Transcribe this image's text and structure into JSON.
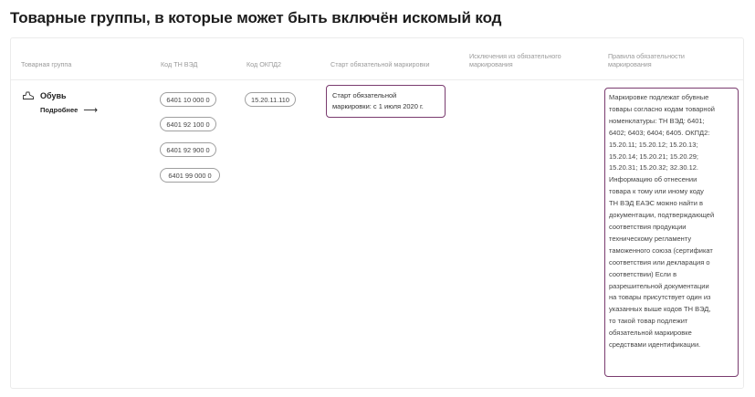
{
  "page": {
    "title": "Товарные группы, в которые может быть включён искомый код"
  },
  "table": {
    "headers": {
      "group": "Товарная группа",
      "tnved": "Код ТН ВЭД",
      "okpd2": "Код ОКПД2",
      "start": "Старт обязательной маркировки",
      "exceptions_line1": "Исключения из обязательного",
      "exceptions_line2": "маркирования",
      "rules_line1": "Правила обязательности",
      "rules_line2": "маркирования"
    },
    "row": {
      "group_icon": "shoe-icon",
      "group_name": "Обувь",
      "more_label": "Подробнее",
      "more_icon": "arrow-right-icon",
      "tnved_codes": [
        "6401 10 000 0",
        "6401 92 100 0",
        "6401 92 900 0",
        "6401 99 000 0"
      ],
      "okpd2_code": "15.20.11.110",
      "start_line1": "Старт обязательной",
      "start_line2": "маркировки: с 1 июля 2020 г.",
      "rules_lines": [
        "Маркировке подлежат обувные",
        "товары согласно кодам товарной",
        "номенклатуры: ТН ВЭД: 6401;",
        "6402; 6403; 6404; 6405. ОКПД2:",
        "15.20.11; 15.20.12; 15.20.13;",
        "15.20.14; 15.20.21; 15.20.29;",
        "15.20.31; 15.20.32; 32.30.12.",
        "Информацию об отнесении",
        "товара к тому или иному коду",
        "ТН ВЭД ЕАЭС можно найти в",
        "документации, подтверждающей",
        "соответствия продукции",
        "техническому регламенту",
        "таможенного союза (сертификат",
        "соответствия или декларация о",
        "соответствии) Если в",
        "разрешительной документации",
        "на товары присутствует один из",
        "указанных выше кодов ТН ВЭД,",
        "то такой товар подлежит",
        "обязательной маркировке",
        "средствами идентификации."
      ]
    },
    "accent_color": "#7a3b6f"
  }
}
